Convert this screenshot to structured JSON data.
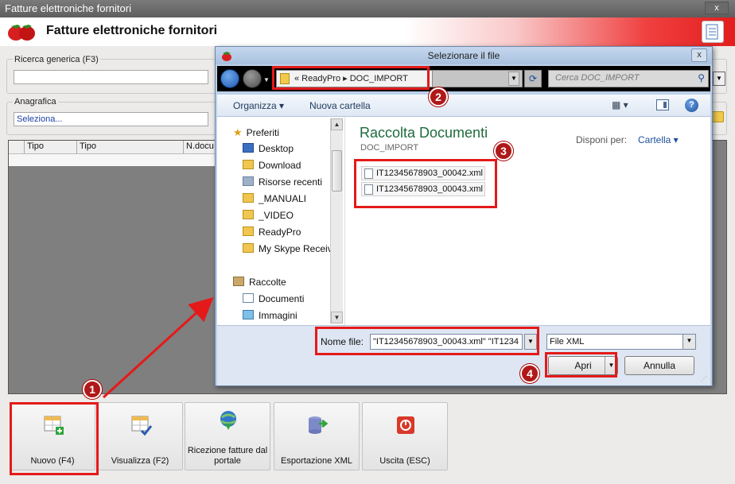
{
  "main_window": {
    "title": "Fatture elettroniche fornitori",
    "app_title": "Fatture elettroniche fornitori",
    "close_label": "x"
  },
  "filters": {
    "search_label": "Ricerca generica (F3)",
    "search_value": "",
    "anagrafica_label": "Anagrafica",
    "anagrafica_value": "Seleziona..."
  },
  "grid": {
    "columns": [
      "Tipo",
      "Tipo",
      "N.docu"
    ]
  },
  "toolbar": [
    {
      "label": "Nuovo (F4)",
      "icon": "grid-add-icon"
    },
    {
      "label": "Visualizza (F2)",
      "icon": "grid-check-icon"
    },
    {
      "label": "Ricezione fatture dal portale",
      "icon": "globe-download-icon"
    },
    {
      "label": "Esportazione XML",
      "icon": "database-export-icon"
    },
    {
      "label": "Uscita (ESC)",
      "icon": "power-icon"
    }
  ],
  "dialog": {
    "title": "Selezionare il file",
    "close_label": "x",
    "address": "«  ReadyPro  ▸  DOC_IMPORT",
    "search_placeholder": "Cerca DOC_IMPORT",
    "organize_label": "Organizza ▾",
    "new_folder_label": "Nuova cartella",
    "nav": {
      "favorites_label": "Preferiti",
      "items": [
        "Desktop",
        "Download",
        "Risorse recenti",
        "_MANUALI",
        "_VIDEO",
        "ReadyPro",
        "My Skype Receiv"
      ],
      "collections_label": "Raccolte",
      "collections": [
        "Documenti",
        "Immagini"
      ]
    },
    "library_title": "Raccolta Documenti",
    "library_sub": "DOC_IMPORT",
    "arrange_label": "Disponi per:",
    "arrange_value": "Cartella ▾",
    "files": [
      "IT12345678903_00042.xml",
      "IT12345678903_00043.xml"
    ],
    "filename_label": "Nome file:",
    "filename_value": "\"IT12345678903_00043.xml\" \"IT1234",
    "filetype_value": "File XML",
    "open_label": "Apri",
    "cancel_label": "Annulla"
  },
  "annotations": {
    "steps": [
      "1",
      "2",
      "3",
      "4"
    ],
    "color": "#e41a1a"
  }
}
